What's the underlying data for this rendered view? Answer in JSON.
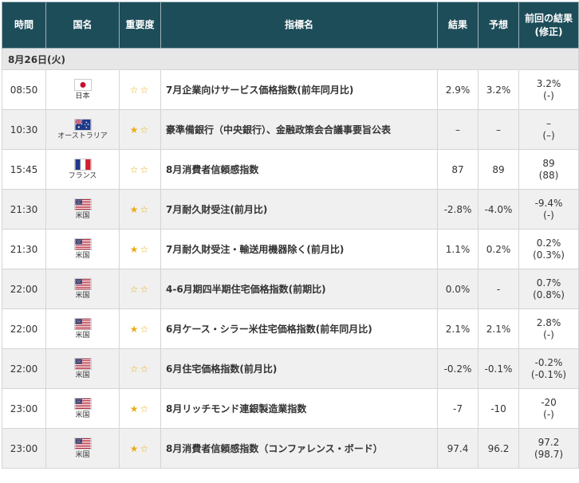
{
  "headers": {
    "time": "時間",
    "country": "国名",
    "importance": "重要度",
    "indicator": "指標名",
    "result": "結果",
    "forecast": "予想",
    "previous_line1": "前回の結果",
    "previous_line2": "(修正)"
  },
  "date_label": "8月26日(火)",
  "colors": {
    "header_bg": "#1e4d5a",
    "link_text": "#1f4e9a",
    "star": "#e8ad17"
  },
  "rows": [
    {
      "time": "08:50",
      "flag": "japan-flag",
      "country": "日本",
      "stars": 0,
      "indicator": "7月企業向けサービス価格指数(前年同月比)",
      "linked": true,
      "result": "2.9%",
      "forecast": "3.2%",
      "previous": "3.2%",
      "revised": "(-)"
    },
    {
      "time": "10:30",
      "flag": "australia-flag",
      "country": "オーストラリア",
      "stars": 1,
      "indicator": "豪準備銀行（中央銀行）、金融政策会合議事要旨公表",
      "linked": false,
      "result": "–",
      "forecast": "–",
      "previous": "–",
      "revised": "(–)"
    },
    {
      "time": "15:45",
      "flag": "france-flag",
      "country": "フランス",
      "stars": 0,
      "indicator": "8月消費者信頼感指数",
      "linked": true,
      "result": "87",
      "forecast": "89",
      "previous": "89",
      "revised": "(88)"
    },
    {
      "time": "21:30",
      "flag": "us-flag",
      "country": "米国",
      "stars": 1,
      "indicator": "7月耐久財受注(前月比)",
      "linked": true,
      "result": "-2.8%",
      "forecast": "-4.0%",
      "previous": "-9.4%",
      "revised": "(-)"
    },
    {
      "time": "21:30",
      "flag": "us-flag",
      "country": "米国",
      "stars": 1,
      "indicator": "7月耐久財受注・輸送用機器除く(前月比)",
      "linked": true,
      "result": "1.1%",
      "forecast": "0.2%",
      "previous": "0.2%",
      "revised": "(0.3%)"
    },
    {
      "time": "22:00",
      "flag": "us-flag",
      "country": "米国",
      "stars": 0,
      "indicator": "4-6月期四半期住宅価格指数(前期比)",
      "linked": true,
      "result": "0.0%",
      "forecast": "-",
      "previous": "0.7%",
      "revised": "(0.8%)"
    },
    {
      "time": "22:00",
      "flag": "us-flag",
      "country": "米国",
      "stars": 1,
      "indicator": "6月ケース・シラー米住宅価格指数(前年同月比)",
      "linked": true,
      "result": "2.1%",
      "forecast": "2.1%",
      "previous": "2.8%",
      "revised": "(-)"
    },
    {
      "time": "22:00",
      "flag": "us-flag",
      "country": "米国",
      "stars": 0,
      "indicator": "6月住宅価格指数(前月比)",
      "linked": true,
      "result": "-0.2%",
      "forecast": "-0.1%",
      "previous": "-0.2%",
      "revised": "(-0.1%)"
    },
    {
      "time": "23:00",
      "flag": "us-flag",
      "country": "米国",
      "stars": 1,
      "indicator": "8月リッチモンド連銀製造業指数",
      "linked": true,
      "result": "-7",
      "forecast": "-10",
      "previous": "-20",
      "revised": "(-)"
    },
    {
      "time": "23:00",
      "flag": "us-flag",
      "country": "米国",
      "stars": 1,
      "indicator": "8月消費者信頼感指数（コンファレンス・ボード）",
      "linked": true,
      "result": "97.4",
      "forecast": "96.2",
      "previous": "97.2",
      "revised": "(98.7)"
    }
  ]
}
